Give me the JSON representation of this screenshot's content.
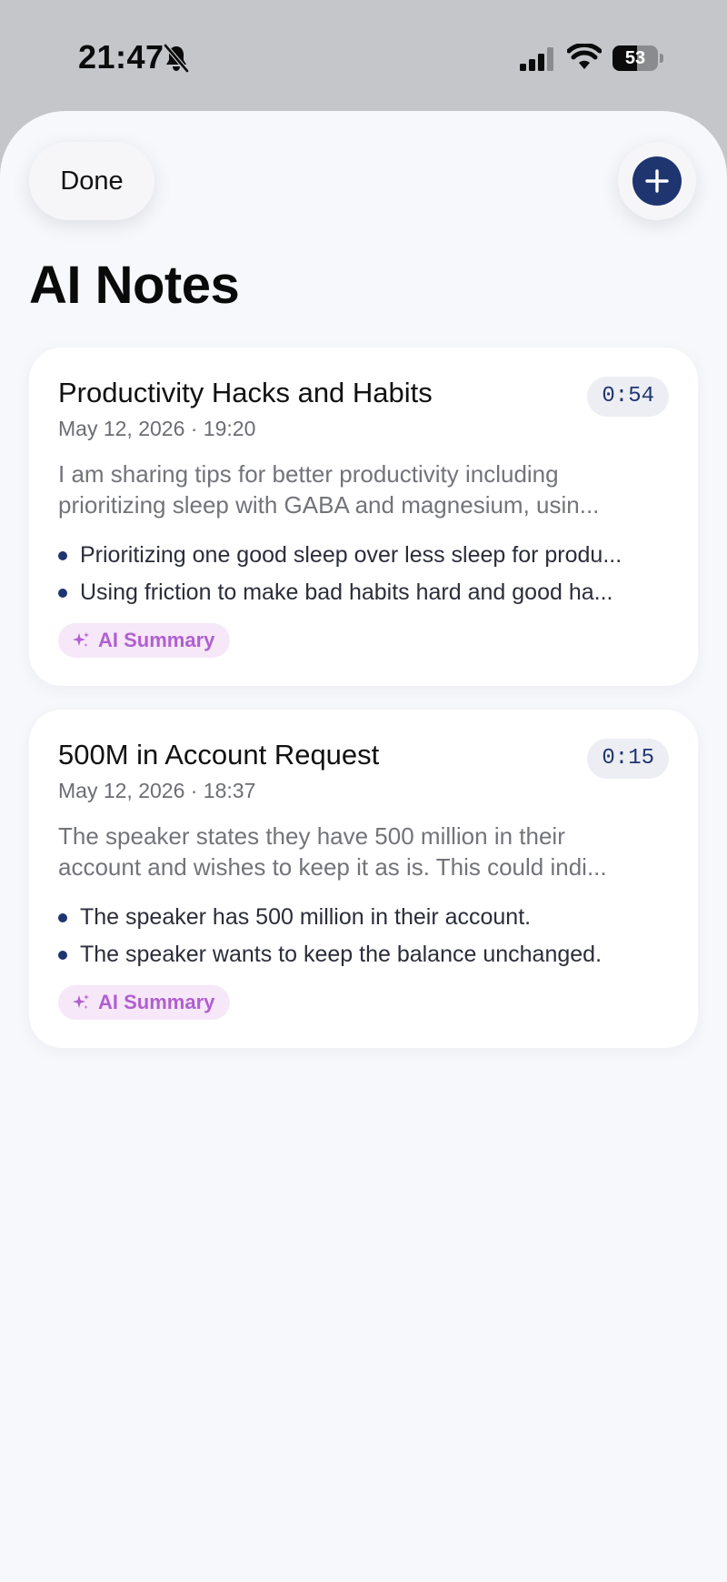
{
  "status_bar": {
    "time": "21:47",
    "battery_level": "53",
    "battery_fraction": 0.53,
    "icons": [
      "bell-slash-icon",
      "cellular-signal-icon",
      "wifi-icon",
      "battery-icon"
    ]
  },
  "header": {
    "done_label": "Done",
    "add_icon": "plus-icon",
    "title": "AI Notes"
  },
  "colors": {
    "accent": "#1f3570",
    "ai_tag_text": "#b05fd0",
    "ai_tag_bg": "#f6e8f8",
    "sheet_bg": "#f7f8fc"
  },
  "notes": [
    {
      "title": "Productivity Hacks and Habits",
      "duration": "0:54",
      "date": "May 12, 2026 · 19:20",
      "summary_line1": "I am sharing tips for better productivity including",
      "summary_line2": "prioritizing sleep with GABA and magnesium, usin...",
      "bullets": [
        "Prioritizing one good sleep over less sleep for produ...",
        "Using friction to make bad habits hard and good ha..."
      ],
      "tag": "AI Summary"
    },
    {
      "title": "500M in Account Request",
      "duration": "0:15",
      "date": "May 12, 2026 · 18:37",
      "summary_line1": "The speaker states they have 500 million in their",
      "summary_line2": "account and wishes to keep it as is. This could indi...",
      "bullets": [
        "The speaker has 500 million in their account.",
        "The speaker wants to keep the balance unchanged."
      ],
      "tag": "AI Summary"
    }
  ]
}
